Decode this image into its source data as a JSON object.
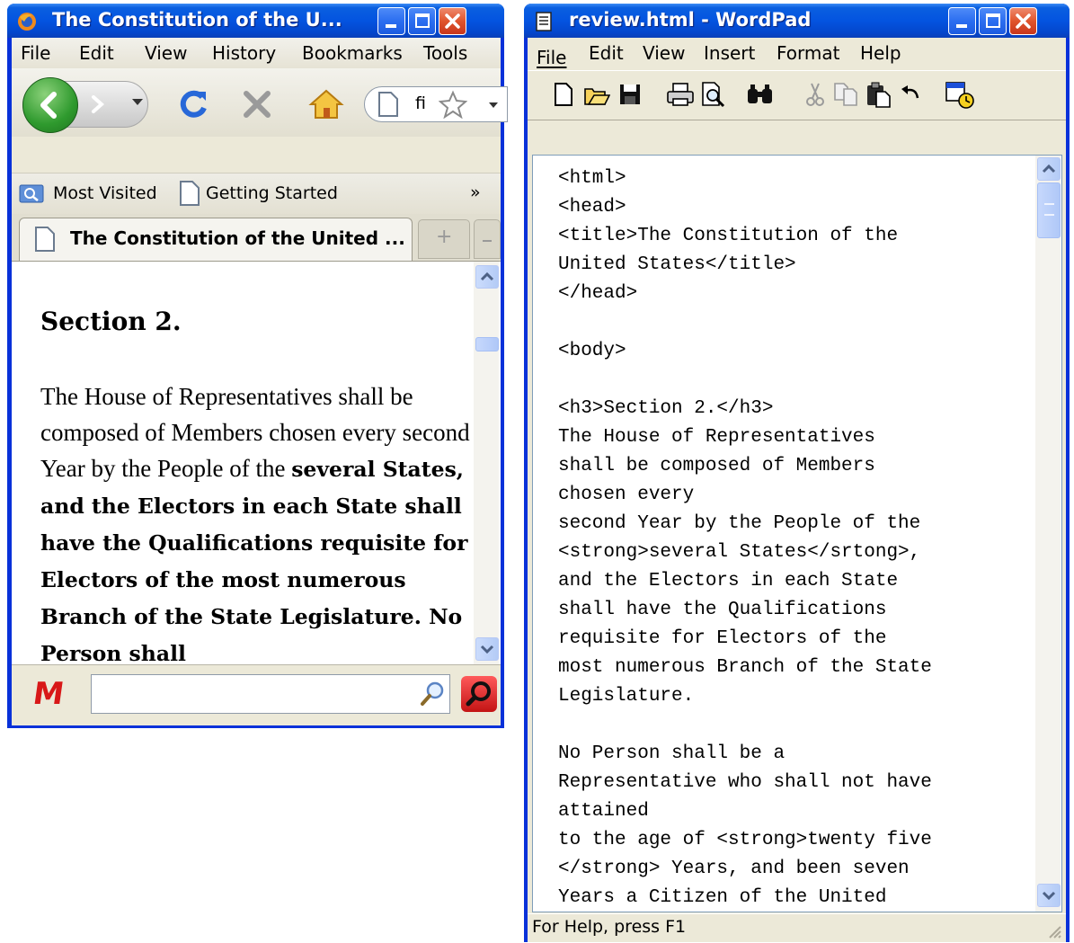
{
  "firefox": {
    "title": "The Constitution of the U...",
    "menu": [
      "File",
      "Edit",
      "View",
      "History",
      "Bookmarks",
      "Tools"
    ],
    "url_text": "fi",
    "bookmarks": [
      "Most Visited",
      "Getting Started"
    ],
    "bookmarks_more": "»",
    "tab_title": "The Constitution of the United ...",
    "new_tab": "+",
    "page": {
      "heading": "Section 2.",
      "normal_text": "The House of Representatives shall be composed of Members chosen every second Year by the People of the",
      "bold_text": "several States, and the Electors in each State shall have the Qualifications requisite for Electors of the most numerous Branch of the State Legislature. No Person shall"
    },
    "search_placeholder": "",
    "addon_logo": "M"
  },
  "wordpad": {
    "title": "review.html - WordPad",
    "menu": [
      "File",
      "Edit",
      "View",
      "Insert",
      "Format",
      "Help"
    ],
    "toolbar_icons": [
      "new-icon",
      "open-icon",
      "save-icon",
      "print-icon",
      "print-preview-icon",
      "find-icon",
      "cut-icon",
      "copy-icon",
      "paste-icon",
      "undo-icon",
      "date-time-icon"
    ],
    "content_lines": [
      "<html>",
      "<head>",
      "<title>The Constitution of the",
      "United States</title>",
      "</head>",
      "",
      "<body>",
      "",
      "<h3>Section 2.</h3>",
      "The House of Representatives",
      "shall be composed of Members",
      "chosen every",
      "second Year by the People of the",
      "<strong>several States</srtong>,",
      "and the Electors in each State",
      "shall have the Qualifications",
      "requisite for Electors of the",
      "most numerous Branch of the State",
      "Legislature.",
      "",
      "No Person shall be a",
      "Representative who shall not have",
      "attained",
      "to the age of <strong>twenty five",
      "</strong> Years, and been seven",
      "Years a Citizen of the United"
    ],
    "status": "For Help, press F1"
  },
  "colors": {
    "xp_title_blue": "#0454e0",
    "xp_face": "#ece9d8",
    "close_red": "#e0542c"
  }
}
